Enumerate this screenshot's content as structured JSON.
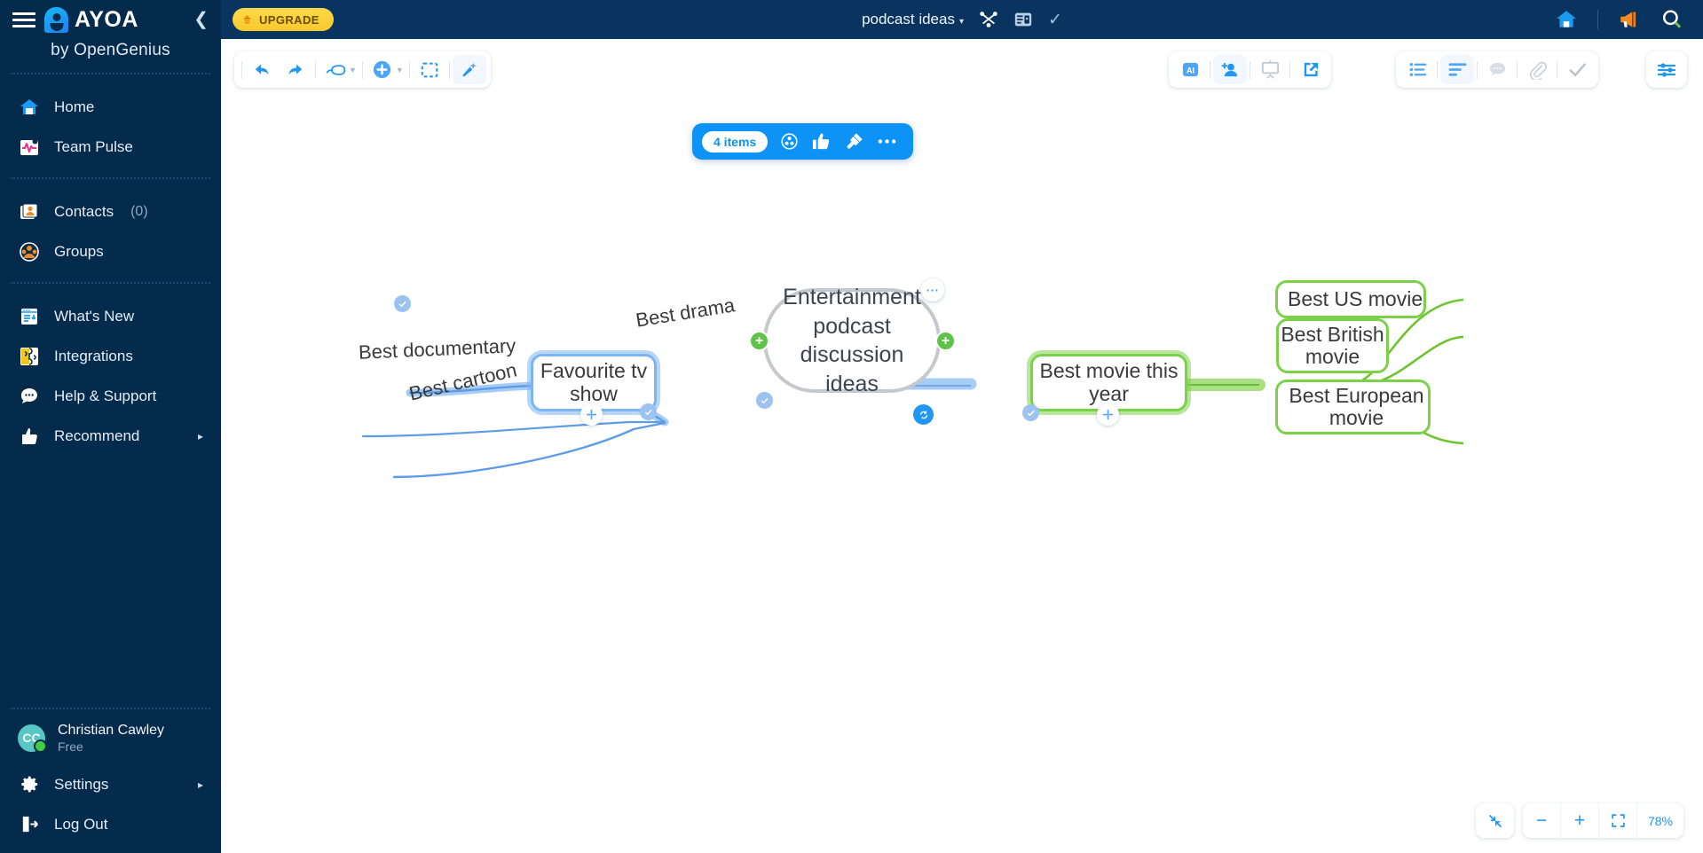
{
  "brand": {
    "name": "AYOA",
    "tagline": "by OpenGenius"
  },
  "sidebar": {
    "groups": [
      {
        "items": [
          {
            "label": "Home",
            "icon": "home-icon"
          },
          {
            "label": "Team Pulse",
            "icon": "pulse-icon"
          }
        ]
      },
      {
        "items": [
          {
            "label": "Contacts",
            "count": "(0)",
            "icon": "contacts-icon"
          },
          {
            "label": "Groups",
            "icon": "groups-icon"
          }
        ]
      },
      {
        "items": [
          {
            "label": "What's New",
            "icon": "whats-new-icon"
          },
          {
            "label": "Integrations",
            "icon": "integrations-icon"
          },
          {
            "label": "Help & Support",
            "icon": "help-icon"
          },
          {
            "label": "Recommend",
            "icon": "recommend-icon",
            "caret": "▸"
          }
        ]
      }
    ],
    "profile": {
      "initials": "CC",
      "name": "Christian Cawley",
      "plan": "Free"
    },
    "settings_label": "Settings",
    "settings_caret": "▸",
    "logout_label": "Log Out"
  },
  "header": {
    "upgrade_label": "UPGRADE",
    "map_title": "podcast ideas",
    "title_caret": "▾",
    "icons": [
      "mindmap-view-icon",
      "board-view-icon",
      "task-check-icon",
      "home-icon",
      "announcements-icon",
      "search-icon"
    ]
  },
  "toolbar_left": {
    "buttons": [
      "undo-icon",
      "redo-icon",
      "branch-style-icon",
      "add-node-icon",
      "select-region-icon",
      "magic-wand-icon"
    ]
  },
  "toolbar_right_1": {
    "buttons": [
      "ai-icon",
      "add-collaborator-icon",
      "presentation-icon",
      "share-export-icon"
    ]
  },
  "toolbar_right_2": {
    "buttons": [
      "outline-list-icon",
      "align-icon",
      "comment-icon",
      "attachment-icon",
      "done-check-icon"
    ]
  },
  "toolbar_right_3": {
    "buttons": [
      "map-settings-icon"
    ]
  },
  "selection_bar": {
    "count_label": "4 items",
    "actions": [
      "lifeboard-icon",
      "thumbs-up-icon",
      "paint-brush-icon",
      "more-options-icon"
    ]
  },
  "zoom_controls": {
    "center_label": "center-map-icon",
    "minus": "−",
    "plus": "+",
    "fit": "fit-to-screen-icon",
    "level": "78%"
  },
  "mindmap": {
    "center_node": "Entertainment podcast discussion ideas",
    "left_branch": {
      "node": "Favourite tv show",
      "color": "#7db4f2",
      "leaves": [
        "Best drama",
        "Best documentary",
        "Best cartoon"
      ]
    },
    "right_branch": {
      "node": "Best movie this year",
      "color": "#7bd24a",
      "leaves": [
        "Best US movie",
        "Best British movie",
        "Best European movie"
      ]
    }
  }
}
